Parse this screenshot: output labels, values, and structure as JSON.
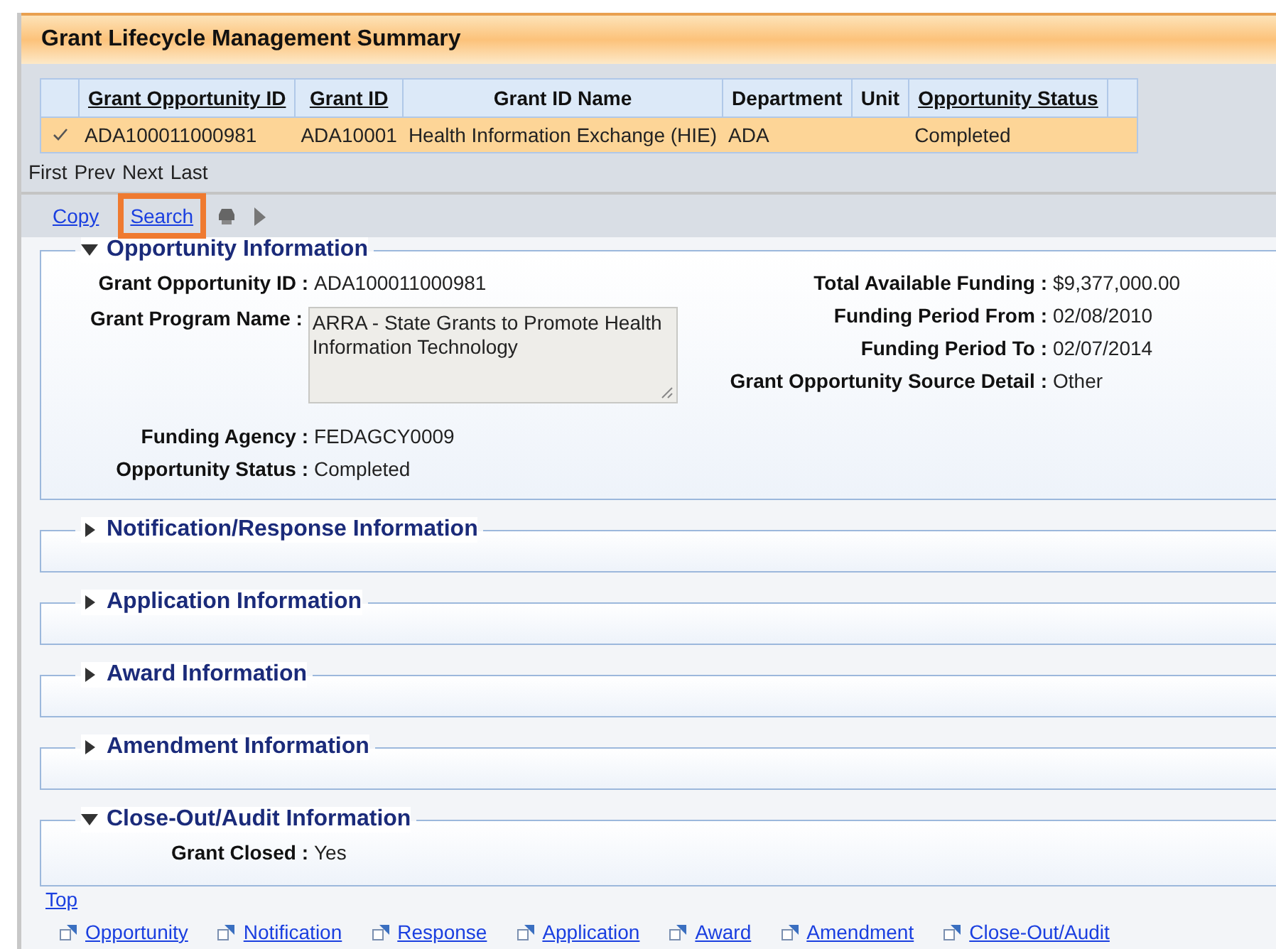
{
  "window": {
    "title": "Grant Lifecycle Management Summary"
  },
  "table": {
    "columns": [
      {
        "label": "Grant Opportunity ID",
        "sortable": true
      },
      {
        "label": "Grant ID",
        "sortable": true
      },
      {
        "label": "Grant ID Name",
        "sortable": false
      },
      {
        "label": "Department",
        "sortable": false
      },
      {
        "label": "Unit",
        "sortable": false
      },
      {
        "label": "Opportunity Status",
        "sortable": true
      }
    ],
    "rows": [
      {
        "selected": true,
        "cells": [
          "ADA100011000981",
          "ADA10001",
          "Health Information Exchange (HIE)",
          "ADA",
          "",
          "Completed"
        ]
      }
    ]
  },
  "pager": [
    "First",
    "Prev",
    "Next",
    "Last"
  ],
  "toolbar": {
    "links": [
      {
        "label": "Copy",
        "highlighted": false
      },
      {
        "label": "Search",
        "highlighted": true
      }
    ]
  },
  "sections": [
    {
      "title": "Opportunity Information",
      "expanded": true,
      "left_fields": [
        {
          "kind": "text",
          "label": "Grant Opportunity ID :",
          "value": "ADA100011000981"
        },
        {
          "kind": "textarea",
          "label": "Grant Program Name :",
          "value": "ARRA - State Grants to Promote Health Information Technology"
        },
        {
          "kind": "text",
          "label": "Funding Agency :",
          "value": "FEDAGCY0009"
        },
        {
          "kind": "text",
          "label": "Opportunity Status :",
          "value": "Completed"
        }
      ],
      "right_fields": [
        {
          "label": "Total Available Funding :",
          "value": "$9,377,000.00"
        },
        {
          "label": "Funding Period From :",
          "value": "02/08/2010"
        },
        {
          "label": "Funding Period To :",
          "value": "02/07/2014"
        },
        {
          "label": "Grant Opportunity Source Detail :",
          "value": "Other"
        }
      ]
    },
    {
      "title": "Notification/Response Information",
      "expanded": false
    },
    {
      "title": "Application Information",
      "expanded": false
    },
    {
      "title": "Award Information",
      "expanded": false
    },
    {
      "title": "Amendment Information",
      "expanded": false
    },
    {
      "title": "Close-Out/Audit Information",
      "expanded": true,
      "left_fields": [
        {
          "kind": "text",
          "label": "Grant Closed :",
          "value": "Yes"
        }
      ]
    }
  ],
  "top_link": "Top",
  "footer_links": [
    "Opportunity",
    "Notification",
    "Response",
    "Application",
    "Award",
    "Amendment",
    "Close-Out/Audit"
  ]
}
